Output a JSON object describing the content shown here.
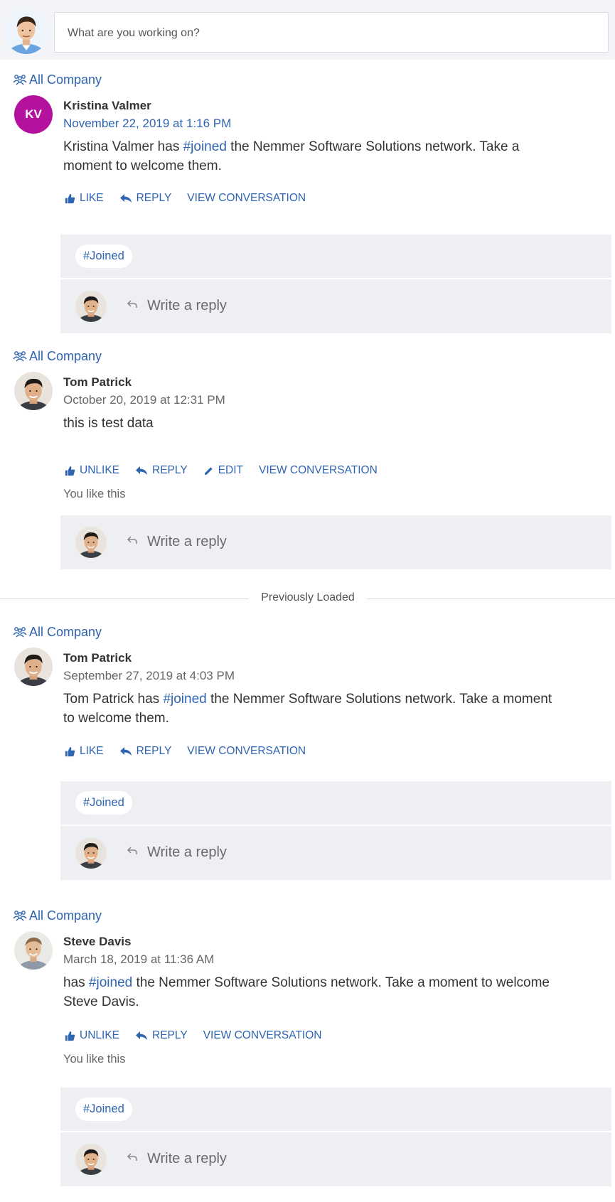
{
  "composer": {
    "placeholder": "What are you working on?"
  },
  "divider": {
    "label": "Previously Loaded"
  },
  "posts": [
    {
      "group": "All Company",
      "author": "Kristina Valmer",
      "initials": "KV",
      "avatar_color": "#b3119e",
      "date": "November 22, 2019 at 1:16 PM",
      "body_pre": "Kristina Valmer has ",
      "body_tag": "#joined",
      "body_post": " the Nemmer Software Solutions network. Take a moment to welcome them.",
      "actions": {
        "like": "LIKE",
        "reply": "REPLY",
        "view": "VIEW CONVERSATION"
      },
      "hashtag": "#Joined",
      "reply_placeholder": "Write a reply"
    },
    {
      "group": "All Company",
      "author": "Tom Patrick",
      "date": "October 20, 2019 at 12:31 PM",
      "body_pre": "this is test data",
      "actions": {
        "like": "UNLIKE",
        "reply": "REPLY",
        "edit": "EDIT",
        "view": "VIEW CONVERSATION"
      },
      "liked_text": "You like this",
      "reply_placeholder": "Write a reply"
    },
    {
      "group": "All Company",
      "author": "Tom Patrick",
      "date": "September 27, 2019 at 4:03 PM",
      "body_pre": "Tom Patrick has ",
      "body_tag": "#joined",
      "body_post": " the Nemmer Software Solutions network. Take a moment to welcome them.",
      "actions": {
        "like": "LIKE",
        "reply": "REPLY",
        "view": "VIEW CONVERSATION"
      },
      "hashtag": "#Joined",
      "reply_placeholder": "Write a reply"
    },
    {
      "group": "All Company",
      "author": "Steve Davis",
      "date": "March 18, 2019 at 11:36 AM",
      "body_pre": "has ",
      "body_tag": "#joined",
      "body_post": " the Nemmer Software Solutions network. Take a moment to welcome Steve Davis.",
      "actions": {
        "like": "UNLIKE",
        "reply": "REPLY",
        "view": "VIEW CONVERSATION"
      },
      "liked_text": "You like this",
      "hashtag": "#Joined",
      "reply_placeholder": "Write a reply"
    }
  ]
}
